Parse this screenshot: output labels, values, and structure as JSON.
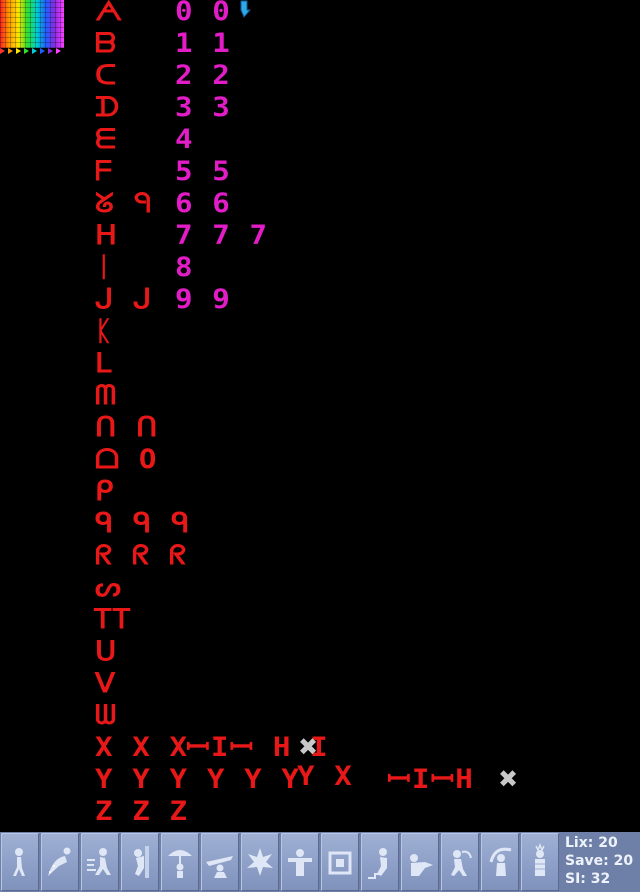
{
  "status": {
    "lix_label": "Lix:",
    "lix_value": "20",
    "save_label": "Save:",
    "save_value": "20",
    "si_label": "SI:",
    "si_value": "32"
  },
  "letters": [
    {
      "text": "ᗅ"
    },
    {
      "text": "ᗷ"
    },
    {
      "text": "ᑕ"
    },
    {
      "text": "ᗪ"
    },
    {
      "text": "ᗴ"
    },
    {
      "text": "ᖴ"
    },
    {
      "text": "ᘜ ᑫ"
    },
    {
      "text": "ᕼ"
    },
    {
      "text": "ᛁ"
    },
    {
      "text": "ᒍ ᒍ"
    },
    {
      "text": "ᛕ"
    },
    {
      "text": "ᒪ"
    },
    {
      "text": "ᗰ"
    },
    {
      "text": "ᑎ ᑎ"
    },
    {
      "text": "ᗝ O"
    },
    {
      "text": "ᑭ"
    },
    {
      "text": "ᑫ ᑫ ᑫ"
    },
    {
      "text": "ᖇ ᖇ ᖇ"
    },
    {
      "text": "ᔕ"
    },
    {
      "text": "ᎢᎢ"
    },
    {
      "text": "ᑌ"
    },
    {
      "text": "ᐯ"
    },
    {
      "text": "ᗯ"
    }
  ],
  "numbers": [
    {
      "text": "0 0"
    },
    {
      "text": "1 1"
    },
    {
      "text": "2 2"
    },
    {
      "text": "3 3"
    },
    {
      "text": "4"
    },
    {
      "text": "5 5"
    },
    {
      "text": "6 6"
    },
    {
      "text": "7 7 7"
    },
    {
      "text": "8"
    },
    {
      "text": "9 9"
    }
  ],
  "bottom_rows": {
    "x_row": "X X X",
    "y_row": "Y Y Y Y Y Y",
    "z_row": "Z Z Z"
  },
  "toolbar": {
    "buttons": [
      {
        "name": "walker-skill-button",
        "icon": "walker-icon"
      },
      {
        "name": "jumper-skill-button",
        "icon": "jumper-icon"
      },
      {
        "name": "runner-skill-button",
        "icon": "runner-icon"
      },
      {
        "name": "climber-skill-button",
        "icon": "climber-icon"
      },
      {
        "name": "floater-skill-button",
        "icon": "floater-icon"
      },
      {
        "name": "glider-skill-button",
        "icon": "glider-icon"
      },
      {
        "name": "exploder-skill-button",
        "icon": "exploder-icon"
      },
      {
        "name": "blocker-skill-button",
        "icon": "blocker-icon"
      },
      {
        "name": "platformer-skill-button",
        "icon": "platformer-icon"
      },
      {
        "name": "builder-skill-button",
        "icon": "builder-icon"
      },
      {
        "name": "basher-skill-button",
        "icon": "basher-icon"
      },
      {
        "name": "miner-skill-button",
        "icon": "miner-icon"
      },
      {
        "name": "digger-skill-button",
        "icon": "digger-icon"
      },
      {
        "name": "cuber-skill-button",
        "icon": "cuber-icon"
      }
    ]
  }
}
